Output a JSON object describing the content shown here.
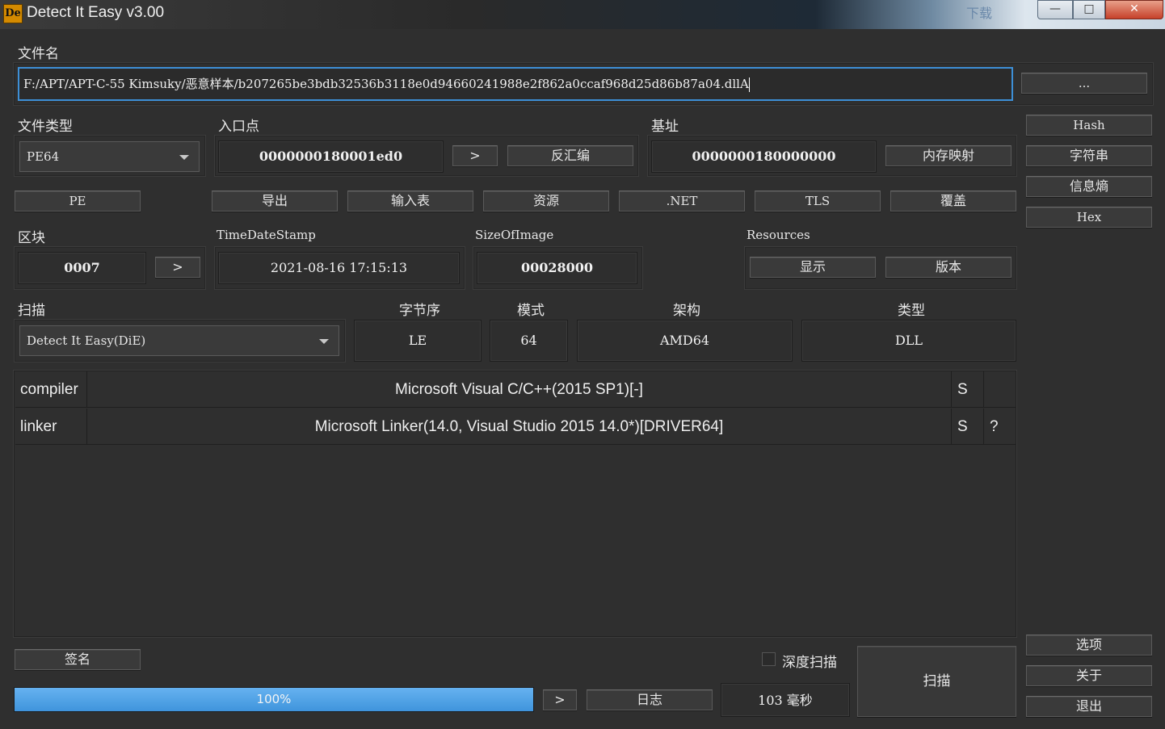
{
  "window": {
    "title": "Detect It Easy v3.00",
    "logo_text": "De",
    "bg_text": "下载",
    "min_glyph": "—",
    "max_glyph": "□",
    "close_glyph": "✕"
  },
  "file": {
    "label": "文件名",
    "path": "F:/APT/APT-C-55 Kimsuky/恶意样本/b207265be3bdb32536b3118e0d94660241988e2f862a0ccaf968d25d86b87a04.dllA",
    "browse_label": "..."
  },
  "filetype": {
    "label": "文件类型",
    "value": "PE64"
  },
  "entry": {
    "label": "入口点",
    "value": "0000000180001ed0",
    "go_label": ">",
    "disasm_label": "反汇编"
  },
  "base": {
    "label": "基址",
    "value": "0000000180000000",
    "memmap_label": "内存映射"
  },
  "side_top": [
    "Hash",
    "字符串",
    "信息熵",
    "Hex"
  ],
  "side_bottom": [
    "选项",
    "关于",
    "退出"
  ],
  "pe_buttons": {
    "pe": "PE",
    "export": "导出",
    "import": "输入表",
    "resource": "资源",
    "net": ".NET",
    "tls": "TLS",
    "overlay": "覆盖"
  },
  "sections": {
    "label": "区块",
    "value": "0007",
    "go_label": ">"
  },
  "timestamp": {
    "label": "TimeDateStamp",
    "value": "2021-08-16 17:15:13"
  },
  "sizeofimage": {
    "label": "SizeOfImage",
    "value": "00028000"
  },
  "resources": {
    "label": "Resources",
    "show_label": "显示",
    "version_label": "版本"
  },
  "scan": {
    "label": "扫描",
    "engine": "Detect It Easy(DiE)",
    "endian_label": "字节序",
    "endian_value": "LE",
    "mode_label": "模式",
    "mode_value": "64",
    "arch_label": "架构",
    "arch_value": "AMD64",
    "type_label": "类型",
    "type_value": "DLL"
  },
  "results": [
    {
      "type": "compiler",
      "name": "Microsoft Visual C/C++(2015 SP1)[-]",
      "s": "S",
      "q": ""
    },
    {
      "type": "linker",
      "name": "Microsoft Linker(14.0, Visual Studio 2015 14.0*)[DRIVER64]",
      "s": "S",
      "q": "?"
    }
  ],
  "bottom": {
    "signature_label": "签名",
    "deep_scan_label": "深度扫描",
    "deep_scan_checked": false,
    "scan_button_label": "扫描",
    "progress_percent": 100,
    "progress_text": "100%",
    "next_label": ">",
    "log_label": "日志",
    "elapsed": "103 毫秒"
  },
  "colors": {
    "accent": "#3d8fd6",
    "progress": "#4f9fe3",
    "background": "#2f2f2f"
  }
}
